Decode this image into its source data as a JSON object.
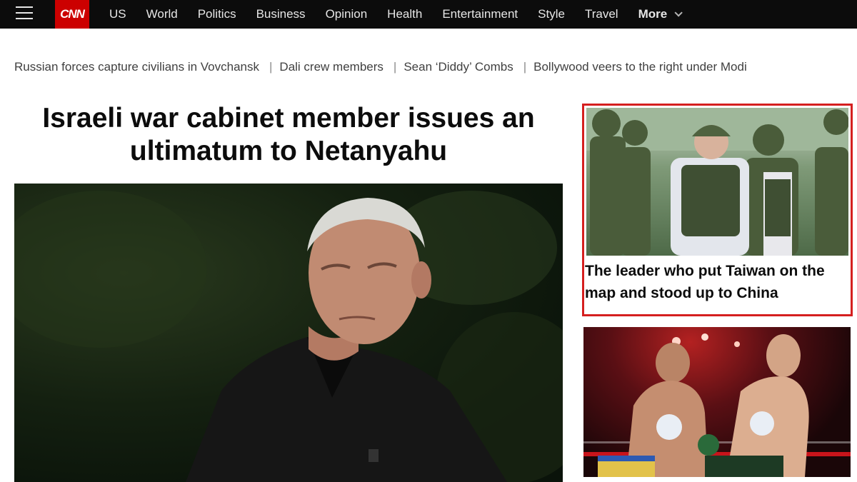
{
  "nav": {
    "logo": "CNN",
    "items": [
      "US",
      "World",
      "Politics",
      "Business",
      "Opinion",
      "Health",
      "Entertainment",
      "Style",
      "Travel"
    ],
    "more_label": "More"
  },
  "trending": [
    "Russian forces capture civilians in Vovchansk",
    "Dali crew members",
    "Sean ‘Diddy’ Combs",
    "Bollywood veers to the right under Modi"
  ],
  "main": {
    "headline": "Israeli war cabinet member issues an ultimatum to Netanyahu"
  },
  "side_cards": [
    {
      "title": "The leader who put Taiwan on the map and stood up to China"
    }
  ],
  "colors": {
    "nav_bg": "#0c0c0c",
    "brand_red": "#cc0000",
    "highlight_border": "#d51f1f"
  }
}
